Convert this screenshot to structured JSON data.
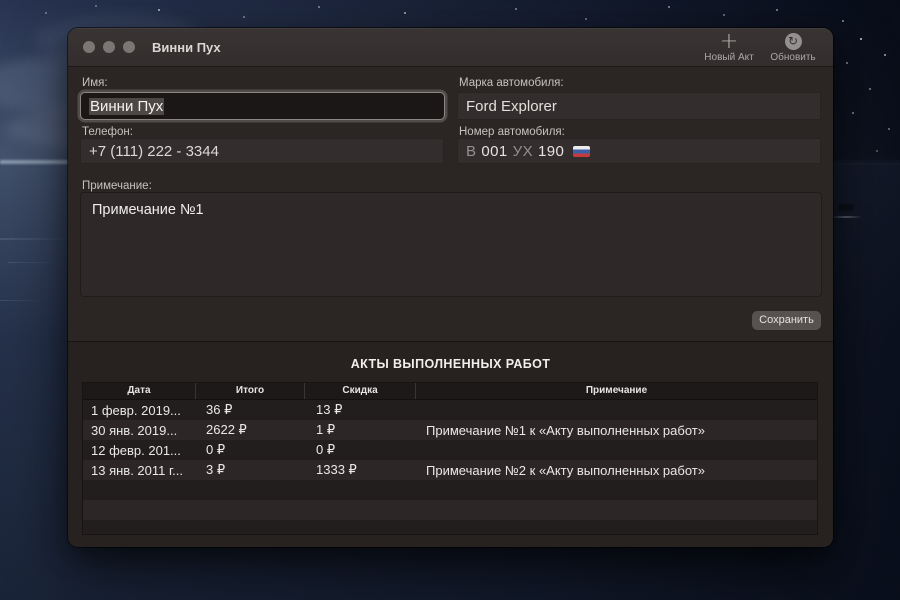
{
  "window": {
    "title": "Винни Пух",
    "toolbar": {
      "new_act": "Новый Акт",
      "refresh": "Обновить"
    }
  },
  "form": {
    "name": {
      "label": "Имя:",
      "value": "Винни Пух"
    },
    "brand": {
      "label": "Марка автомобиля:",
      "value": "Ford Explorer"
    },
    "phone": {
      "label": "Телефон:",
      "value": "+7 (111) 222 - 3344"
    },
    "plate": {
      "label": "Номер автомобиля:",
      "series": "В",
      "number": "001",
      "letters": "УХ",
      "region": "190",
      "flag": "russia"
    },
    "note": {
      "label": "Примечание:",
      "value": "Примечание №1"
    },
    "save_label": "Сохранить"
  },
  "acts": {
    "title": "АКТЫ ВЫПОЛНЕННЫХ РАБОТ",
    "columns": [
      "Дата",
      "Итого",
      "Скидка",
      "Примечание"
    ],
    "rows": [
      {
        "date": "1 февр. 2019...",
        "total": "36 ₽",
        "discount": "13 ₽",
        "note": ""
      },
      {
        "date": "30 янв. 2019...",
        "total": "2622 ₽",
        "discount": "1 ₽",
        "note": "Примечание №1 к «Акту выполненных работ»"
      },
      {
        "date": "12 февр. 201...",
        "total": "0 ₽",
        "discount": "0 ₽",
        "note": ""
      },
      {
        "date": "13 янв. 2011 г...",
        "total": "3 ₽",
        "discount": "1333 ₽",
        "note": "Примечание №2 к «Акту выполненных работ»"
      }
    ]
  },
  "colors": {
    "selection": "#4d4846",
    "flag_white": "#ececec",
    "flag_blue": "#3d5fa8",
    "flag_red": "#c53b3b"
  }
}
